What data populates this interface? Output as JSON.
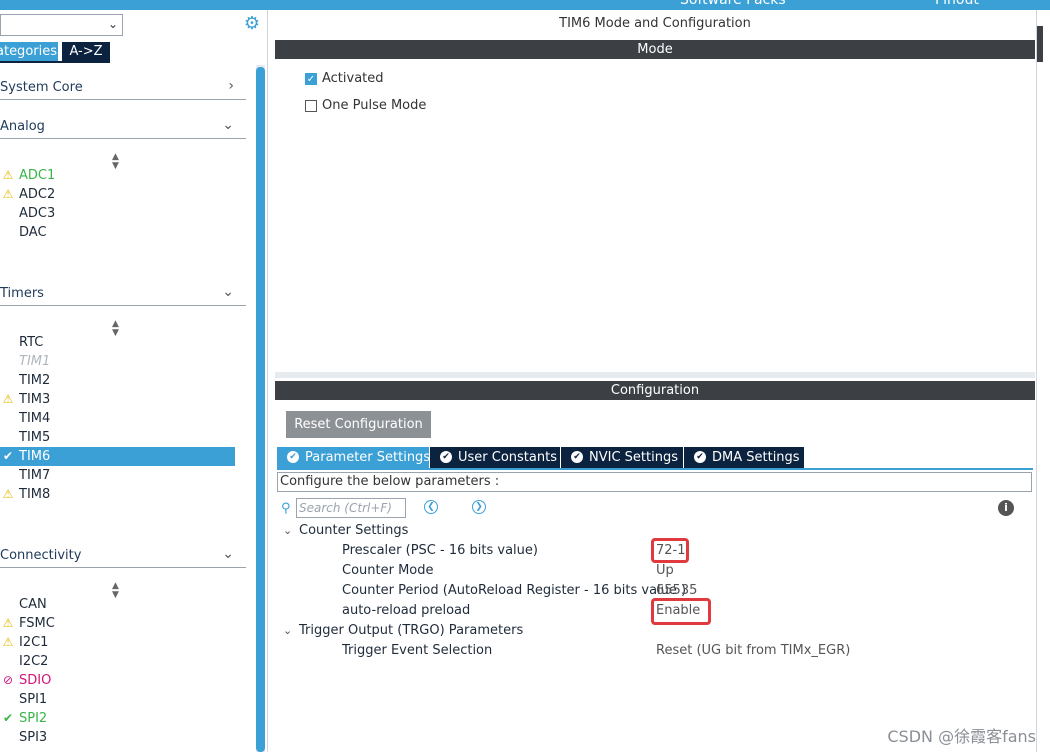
{
  "topbar": {
    "software_packs": "Software Packs",
    "pinout": "Pinout"
  },
  "sidebar": {
    "tab_categories": "ategories",
    "tab_az": "A->Z",
    "sections": {
      "system_core": "System Core",
      "analog": "Analog",
      "timers": "Timers",
      "connectivity": "Connectivity"
    },
    "analog_items": [
      {
        "name": "ADC1",
        "status": "warn-green"
      },
      {
        "name": "ADC2",
        "status": "warn"
      },
      {
        "name": "ADC3",
        "status": "none"
      },
      {
        "name": "DAC",
        "status": "none"
      }
    ],
    "timer_items": [
      {
        "name": "RTC",
        "status": "none"
      },
      {
        "name": "TIM1",
        "status": "disabled"
      },
      {
        "name": "TIM2",
        "status": "none"
      },
      {
        "name": "TIM3",
        "status": "warn"
      },
      {
        "name": "TIM4",
        "status": "none"
      },
      {
        "name": "TIM5",
        "status": "none"
      },
      {
        "name": "TIM6",
        "status": "selected"
      },
      {
        "name": "TIM7",
        "status": "none"
      },
      {
        "name": "TIM8",
        "status": "warn"
      }
    ],
    "connectivity_items": [
      {
        "name": "CAN",
        "status": "none"
      },
      {
        "name": "FSMC",
        "status": "warn"
      },
      {
        "name": "I2C1",
        "status": "warn"
      },
      {
        "name": "I2C2",
        "status": "none"
      },
      {
        "name": "SDIO",
        "status": "error"
      },
      {
        "name": "SPI1",
        "status": "none"
      },
      {
        "name": "SPI2",
        "status": "ok"
      },
      {
        "name": "SPI3",
        "status": "none"
      }
    ]
  },
  "panel": {
    "title": "TIM6 Mode and Configuration",
    "mode_header": "Mode",
    "activated": "Activated",
    "one_pulse": "One Pulse Mode",
    "config_header": "Configuration",
    "reset_button": "Reset Configuration",
    "tabs": [
      "Parameter Settings",
      "User Constants",
      "NVIC Settings",
      "DMA Settings"
    ],
    "configure_text": "Configure the below parameters :",
    "search_placeholder": "Search (Ctrl+F)",
    "counter_settings": "Counter Settings",
    "params": [
      {
        "label": "Prescaler (PSC - 16 bits value)",
        "value": "72-1"
      },
      {
        "label": "Counter Mode",
        "value": "Up"
      },
      {
        "label": "Counter Period (AutoReload Register - 16 bits value )",
        "value": "65535"
      },
      {
        "label": "auto-reload preload",
        "value": "Enable"
      }
    ],
    "trgo_group": "Trigger Output (TRGO) Parameters",
    "trgo_param": {
      "label": "Trigger Event Selection",
      "value": "Reset (UG bit from TIMx_EGR)"
    }
  },
  "watermark": "CSDN @徐霞客fans",
  "colors": {
    "accent": "#3aa0d6",
    "navy": "#0c2340",
    "header_bar": "#3c4045",
    "highlight": "#e0393e"
  }
}
